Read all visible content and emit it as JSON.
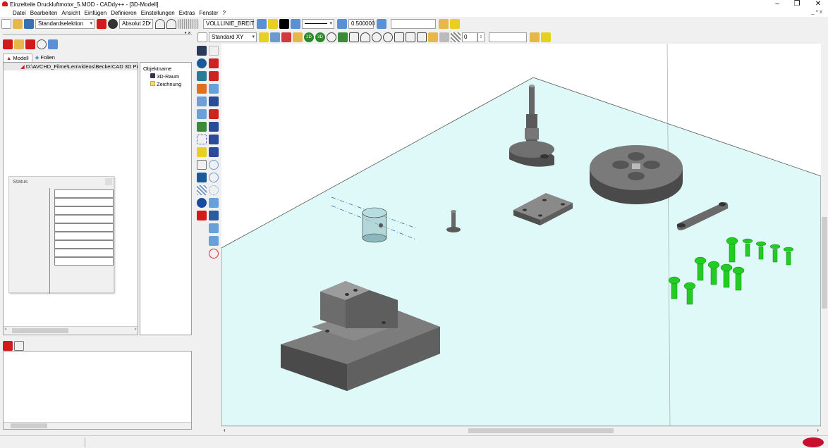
{
  "window": {
    "title": "Einzelteile Druckluftmotor_5.MOD - CADdy++ - [3D-Modell]",
    "minimize": "–",
    "restore": "❐",
    "close": "✕",
    "inner_min": "_",
    "inner_restore": "ᵊ",
    "inner_close": "x"
  },
  "menu": {
    "items": [
      "Datei",
      "Bearbeiten",
      "Ansicht",
      "Einfügen",
      "Definieren",
      "Einstellungen",
      "Extras",
      "Fenster",
      "?"
    ]
  },
  "toolbar1": {
    "selection_mode": "Standardselektion",
    "coord_mode": "Absolut 2D",
    "line_style": "VOLLLINIE_BREIT",
    "line_width": "0.500000"
  },
  "toolbar2": {
    "view": "Standard XY",
    "badge_2d": "2D",
    "badge_3d": "3D",
    "spin_value": "0"
  },
  "left_panel": {
    "tabs": [
      "Modell",
      "Folien"
    ],
    "file_path": "D:\\AVCHD_Filme\\Lernvideos\\BeckerCAD 3D Pr",
    "object_header": "Objektname",
    "objects": [
      "3D-Raum",
      "Zeichnung"
    ],
    "status_title": "Status"
  },
  "colors": {
    "floor": "#dff8f8",
    "part_dark": "#5a5a5a",
    "part_mid": "#7a7a7a",
    "part_light": "#9c9c9c",
    "screws": "#22cc22",
    "accent_red": "#d21a1a"
  }
}
